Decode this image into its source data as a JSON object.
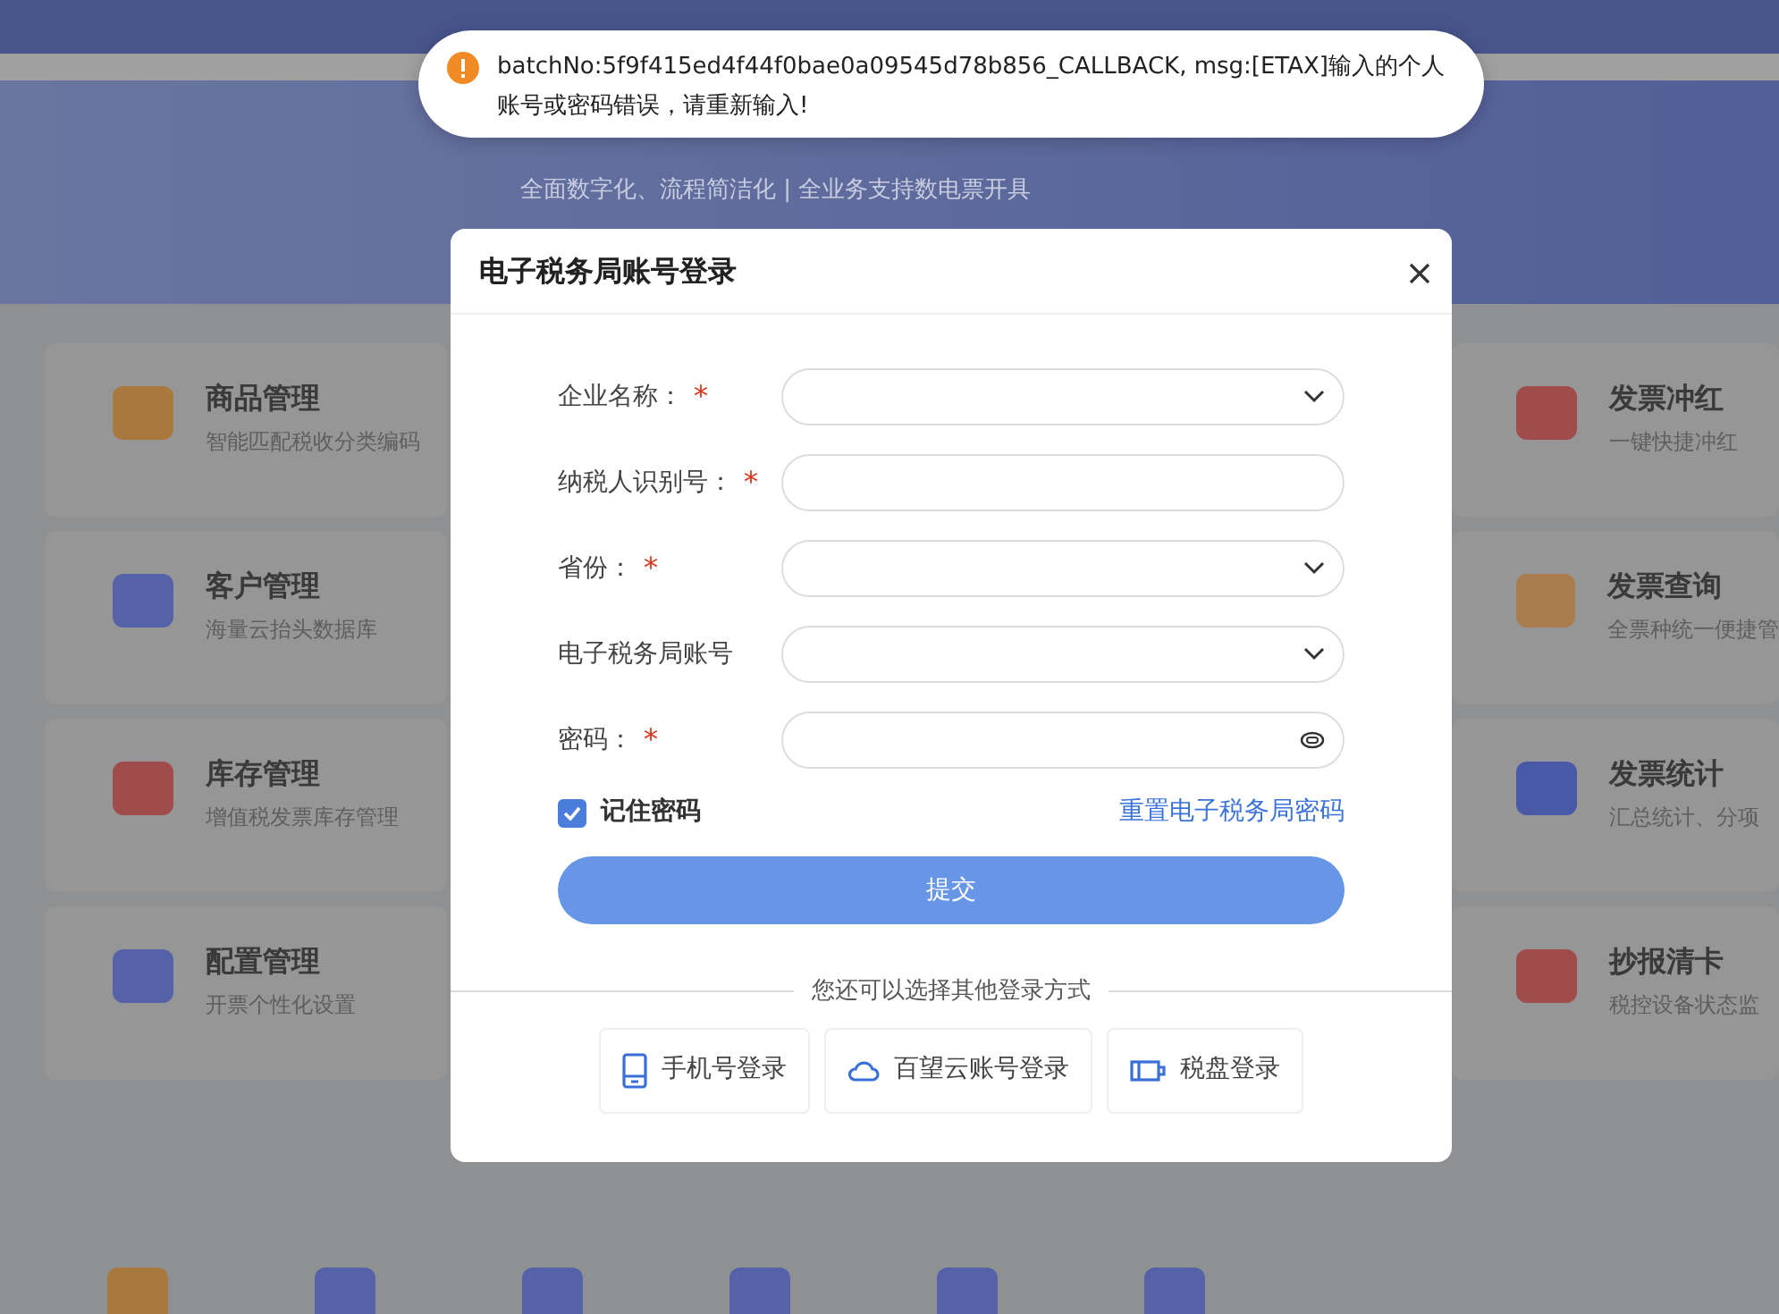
{
  "banner": {
    "subtitle": "全面数字化、流程简洁化 | 全业务支持数电票开具"
  },
  "left_cards": [
    {
      "title": "商品管理",
      "desc": "智能匹配税收分类编码",
      "color": "#a8783c"
    },
    {
      "title": "客户管理",
      "desc": "海量云抬头数据库",
      "color": "#5662a8"
    },
    {
      "title": "库存管理",
      "desc": "增值税发票库存管理",
      "color": "#a04c4c"
    },
    {
      "title": "配置管理",
      "desc": "开票个性化设置",
      "color": "#5662a8"
    }
  ],
  "right_cards": [
    {
      "title": "发票冲红",
      "desc": "一键快捷冲红",
      "color": "#a04c4c"
    },
    {
      "title": "发票查询",
      "desc": "全票种统一便捷管",
      "color": "#a87c4c"
    },
    {
      "title": "发票统计",
      "desc": "汇总统计、分项",
      "color": "#4a58a8"
    },
    {
      "title": "抄报清卡",
      "desc": "税控设备状态监",
      "color": "#a04c4c"
    }
  ],
  "toast": {
    "message": "batchNo:5f9f415ed4f44f0bae0a09545d78b856_CALLBACK, msg:[ETAX]输入的个人账号或密码错误，请重新输入!"
  },
  "dialog": {
    "title": "电子税务局账号登录",
    "fields": [
      {
        "label": "企业名称：",
        "required_mark": "*",
        "kind": "select"
      },
      {
        "label": "纳税人识别号：",
        "required_mark": "*",
        "kind": "text"
      },
      {
        "label": "省份：",
        "required_mark": "*",
        "kind": "select"
      },
      {
        "label": "电子税务局账号",
        "kind": "select"
      },
      {
        "label": "密码：",
        "required_mark": "*",
        "kind": "password"
      }
    ],
    "remember": {
      "label": "记住密码",
      "checked": true
    },
    "reset_link": "重置电子税务局密码",
    "submit": "提交",
    "other_methods": "您还可以选择其他登录方式",
    "methods": [
      {
        "label": "手机号登录",
        "kind": "phone"
      },
      {
        "label": "百望云账号登录",
        "kind": "cloud"
      },
      {
        "label": "税盘登录",
        "kind": "disk"
      }
    ]
  }
}
